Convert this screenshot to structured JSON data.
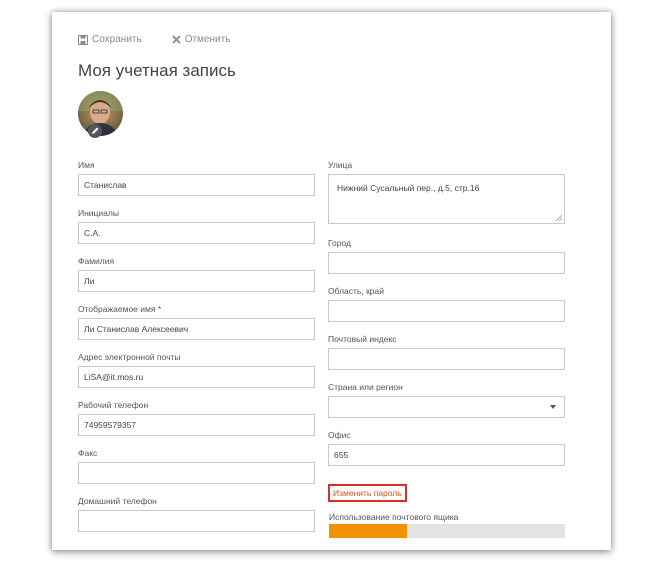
{
  "toolbar": {
    "save_label": "Сохранить",
    "cancel_label": "Отменить"
  },
  "page_title": "Моя учетная запись",
  "left_fields": [
    {
      "label": "Имя",
      "value": "Станислав"
    },
    {
      "label": "Инициалы",
      "value": "С.А."
    },
    {
      "label": "Фамилия",
      "value": "Ли"
    },
    {
      "label": "Отображаемое имя *",
      "value": "Ли Станислав Алексеевич"
    },
    {
      "label": "Адрес электронной почты",
      "value": "LiSA@it.mos.ru"
    },
    {
      "label": "Рабочий телефон",
      "value": "74959579357"
    },
    {
      "label": "Факс",
      "value": ""
    },
    {
      "label": "Домашний телефон",
      "value": ""
    }
  ],
  "street": {
    "label": "Улица",
    "value": "Нижний Сусальный пер., д.5, стр.16"
  },
  "right_fields": [
    {
      "label": "Город",
      "value": ""
    },
    {
      "label": "Область, край",
      "value": ""
    },
    {
      "label": "Почтовый индекс",
      "value": ""
    }
  ],
  "country": {
    "label": "Страна или регион",
    "value": ""
  },
  "office": {
    "label": "Офис",
    "value": "655"
  },
  "change_password": "Изменить пароль",
  "mailbox_usage": {
    "label": "Использование почтового ящика",
    "fraction": 0.33
  },
  "colors": {
    "accent": "#f39200",
    "link": "#e04e1b",
    "highlight_border": "#d9312a"
  }
}
